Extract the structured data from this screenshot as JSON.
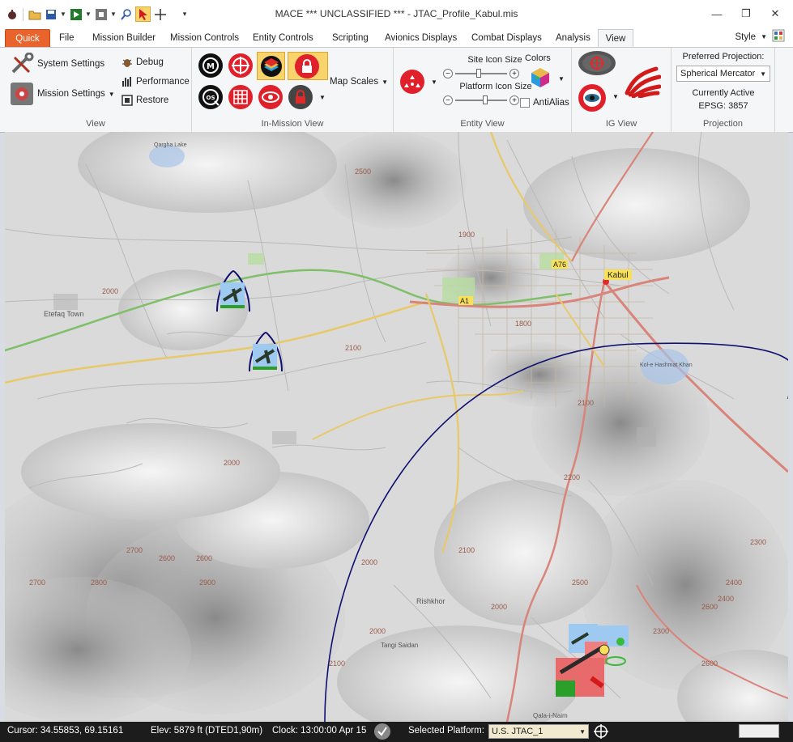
{
  "window": {
    "title": "MACE  *** UNCLASSIFIED ***  - JTAC_Profile_Kabul.mis"
  },
  "tabs": [
    {
      "label": "Quick"
    },
    {
      "label": "File"
    },
    {
      "label": "Mission Builder"
    },
    {
      "label": "Mission Controls"
    },
    {
      "label": "Entity  Controls"
    },
    {
      "label": "Scripting"
    },
    {
      "label": "Avionics Displays"
    },
    {
      "label": "Combat Displays"
    },
    {
      "label": "Analysis"
    },
    {
      "label": "View"
    }
  ],
  "style_menu": {
    "label": "Style"
  },
  "ribbon": {
    "view_group": {
      "caption": "View",
      "system_settings": "System Settings",
      "mission_settings": "Mission Settings",
      "debug": "Debug",
      "performance": "Performance",
      "restore": "Restore"
    },
    "in_mission_group": {
      "caption": "In-Mission View",
      "map_scales": "Map Scales"
    },
    "entity_group": {
      "caption": "Entity View",
      "site_icon_size": "Site Icon Size",
      "platform_icon_size": "Platform Icon Size",
      "colors": "Colors",
      "antialias": "AntiAlias"
    },
    "ig_group": {
      "caption": "IG View"
    },
    "projection_group": {
      "caption": "Projection",
      "preferred_label": "Preferred Projection:",
      "selected": "Spherical Mercator",
      "active_label": "Currently Active",
      "epsg": "EPSG: 3857"
    }
  },
  "map": {
    "labels": {
      "kabul": "Kabul",
      "a1": "A1",
      "a76": "A76",
      "etefaq": "Etefaq Town",
      "rishkhor": "Rishkhor",
      "tangi": "Tangi Saidan",
      "qalai": "Qala-i-Naim",
      "qargha": "Qargha Lake",
      "kabul_lake": "Kol-e Hashmat Khan"
    },
    "contours": [
      "2500",
      "2000",
      "2100",
      "1900",
      "1800",
      "2000",
      "2100",
      "2600",
      "2700",
      "2600",
      "2800",
      "2000",
      "2000",
      "2100",
      "2200",
      "2600",
      "2400",
      "2300",
      "2700",
      "2900",
      "2600",
      "2500",
      "2000",
      "2100",
      "2400",
      "2300"
    ]
  },
  "status": {
    "cursor": "Cursor: 34.55853, 69.15161",
    "elev": "Elev: 5879 ft (DTED1,90m)",
    "clock": "Clock: 13:00:00  Apr 15",
    "selected_label": "Selected Platform:",
    "selected_value": "U.S. JTAC_1"
  },
  "colors": {
    "accent": "#e8642c",
    "road_yellow": "#e8c96a",
    "road_red": "#d9847a",
    "road_green": "#7fbf6a",
    "range_ring": "#101070"
  }
}
